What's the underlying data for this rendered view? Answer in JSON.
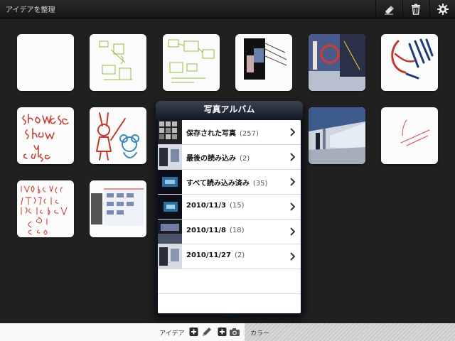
{
  "app": {
    "title": "アイデアを整理"
  },
  "toolbar": {
    "icons": [
      "eraser-icon",
      "trash-icon",
      "gear-icon"
    ]
  },
  "popover": {
    "title": "写真アルバム",
    "albums": [
      {
        "label": "保存された写真",
        "count": "(257)"
      },
      {
        "label": "最後の読み込み",
        "count": "(2)"
      },
      {
        "label": "すべて読み込み済み",
        "count": "(35)"
      },
      {
        "label": "2010/11/3",
        "count": "(15)"
      },
      {
        "label": "2010/11/8",
        "count": "(18)"
      },
      {
        "label": "2010/11/27",
        "count": "(2)"
      }
    ]
  },
  "bottombar": {
    "idea_label": "アイデア",
    "color_label": "カラー"
  },
  "colors": {
    "background": "#202020",
    "ink_red": "#c0392b",
    "ink_green": "#8fbf3f",
    "ink_blue": "#1f3b73"
  }
}
